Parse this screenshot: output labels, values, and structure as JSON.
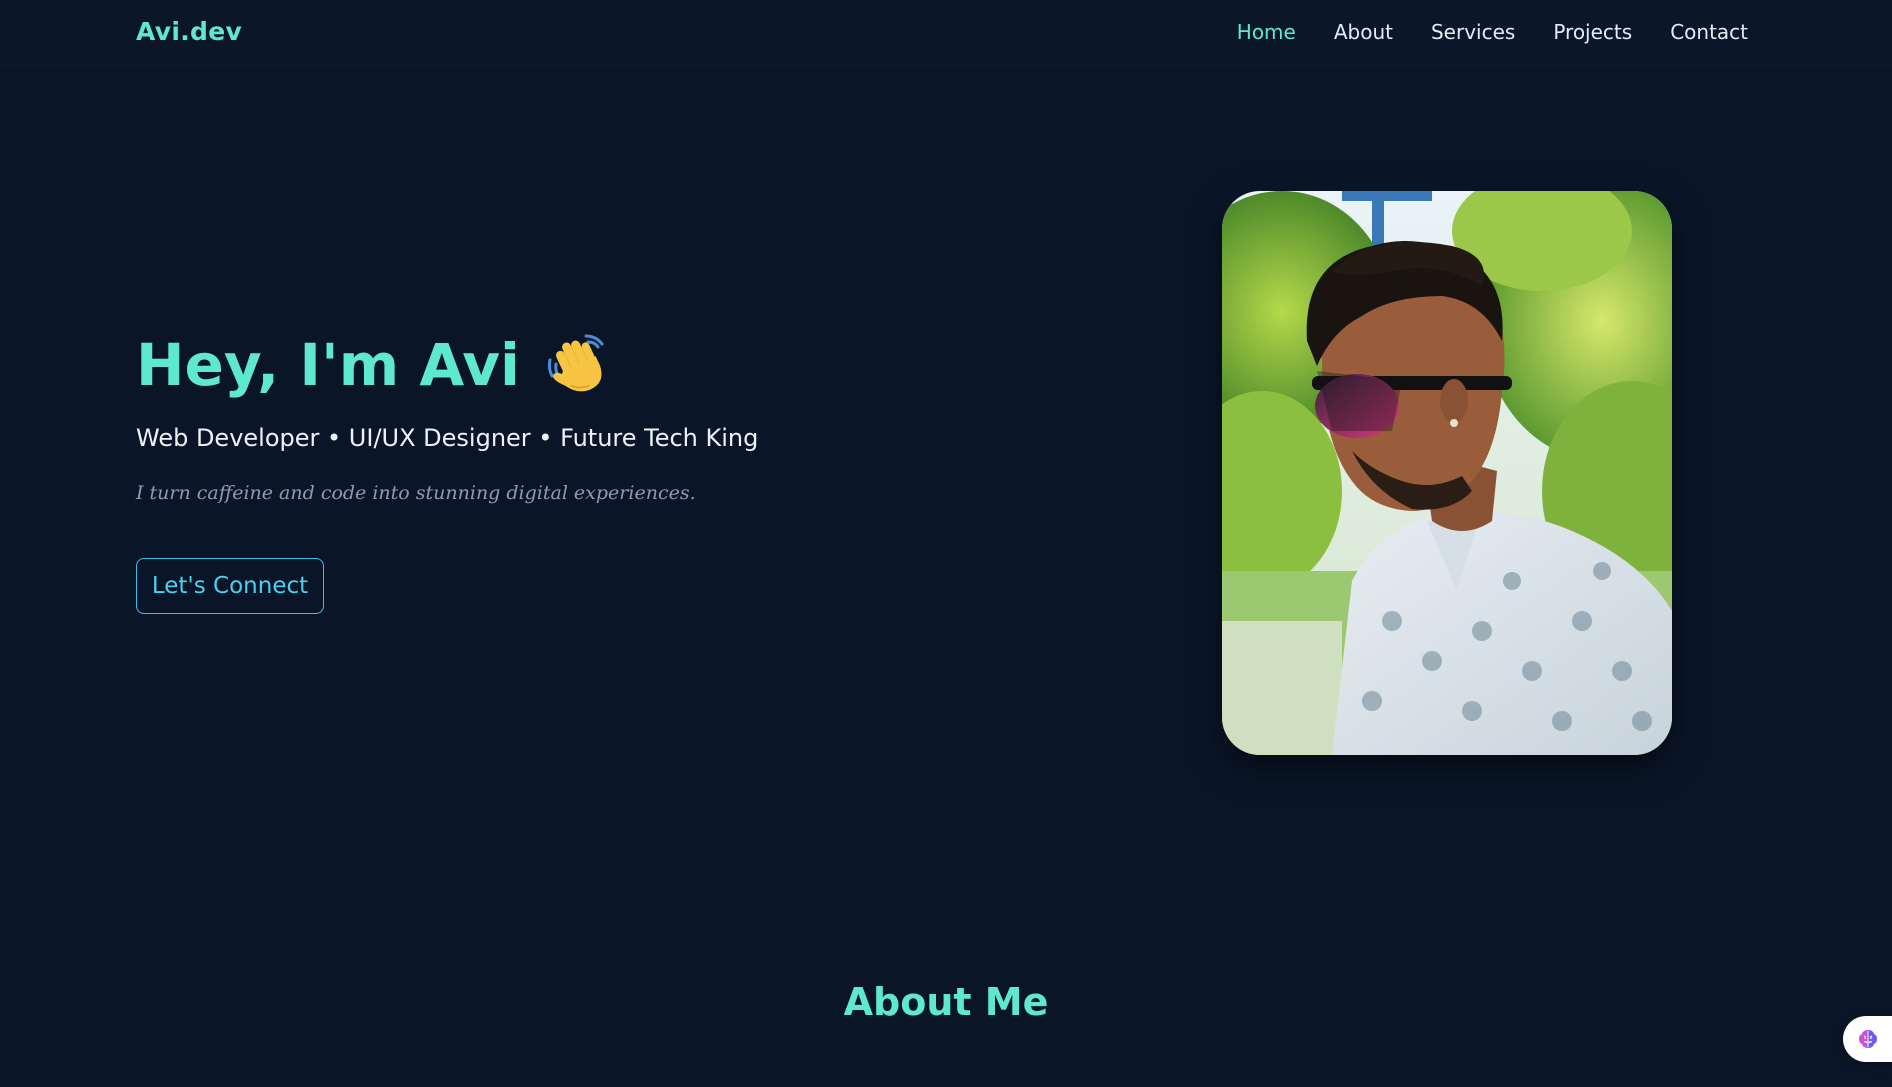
{
  "nav": {
    "brand": "Avi.dev",
    "links": [
      {
        "label": "Home",
        "active": true
      },
      {
        "label": "About",
        "active": false
      },
      {
        "label": "Services",
        "active": false
      },
      {
        "label": "Projects",
        "active": false
      },
      {
        "label": "Contact",
        "active": false
      }
    ]
  },
  "hero": {
    "title": "Hey, I'm Avi",
    "title_icon": "waving-hand-icon",
    "subtitle": "Web Developer • UI/UX Designer • Future Tech King",
    "tagline": "I turn caffeine and code into stunning digital experiences.",
    "cta_label": "Let's Connect",
    "photo": "profile-photo"
  },
  "about": {
    "heading": "About Me"
  },
  "floating": {
    "icon": "brain-icon"
  },
  "colors": {
    "background": "#0a1628",
    "accent": "#5ee8cf",
    "cta": "#4ad0f0",
    "text": "#eef2f8",
    "muted": "#8f9bb5"
  }
}
